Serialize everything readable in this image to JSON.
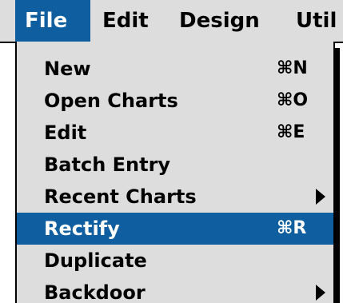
{
  "menubar": {
    "items": [
      {
        "label": "File"
      },
      {
        "label": "Edit"
      },
      {
        "label": "Design"
      },
      {
        "label": "Util"
      }
    ]
  },
  "file_menu": {
    "items": [
      {
        "label": "New",
        "shortcut": "⌘N"
      },
      {
        "label": "Open Charts",
        "shortcut": "⌘O"
      },
      {
        "label": "Edit",
        "shortcut": "⌘E"
      },
      {
        "label": "Batch Entry",
        "shortcut": ""
      },
      {
        "label": "Recent Charts",
        "shortcut": ""
      },
      {
        "label": "Rectify",
        "shortcut": "⌘R"
      },
      {
        "label": "Duplicate",
        "shortcut": ""
      },
      {
        "label": "Backdoor",
        "shortcut": ""
      }
    ]
  },
  "colors": {
    "highlight": "#0f5ea0",
    "menu_background": "#dddddd"
  }
}
